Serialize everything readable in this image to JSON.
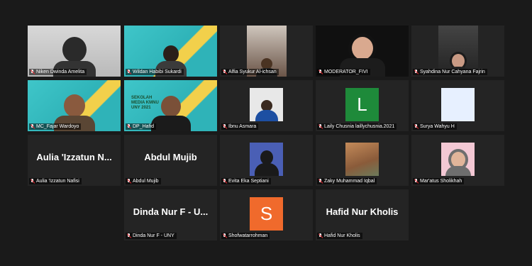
{
  "participants": [
    {
      "name": "Niken Dwinda Amelita"
    },
    {
      "name": "Wildan Habibi Sukardi"
    },
    {
      "name": "Alfia Syukur Al-ichsan"
    },
    {
      "name": "MODERATOR_FIVI"
    },
    {
      "name": "Syahdina Nur Cahyana Fajrin"
    },
    {
      "name": "MC_Fajar Wardoyo"
    },
    {
      "name": "DP_Hafid"
    },
    {
      "name": "Ibnu Asmara"
    },
    {
      "name": "Laily Chusnia laillychusnia.2021"
    },
    {
      "name": "Surya Wahyu H"
    },
    {
      "name": "Aulia 'Izzatun Nafisi",
      "display": "Aulia 'Izzatun N..."
    },
    {
      "name": "Abdul Mujib",
      "display": "Abdul Mujib"
    },
    {
      "name": "Evita Eka Septiani"
    },
    {
      "name": "Zaky Muhammad Iqbal"
    },
    {
      "name": "Mar'atus Sholikhah"
    },
    {
      "name": "Dinda Nur F - UNY",
      "display": "Dinda Nur F - U..."
    },
    {
      "name": "Shofwatarrohman",
      "initial": "S",
      "color": "#f06a2c"
    },
    {
      "name": "Hafid Nur Kholis",
      "display": "Hafid Nur Kholis"
    }
  ],
  "laily_initial": "L",
  "laily_color": "#1e8a3a",
  "banner_text": "SEKOLAH MEDIA KMNU UNY 2021"
}
